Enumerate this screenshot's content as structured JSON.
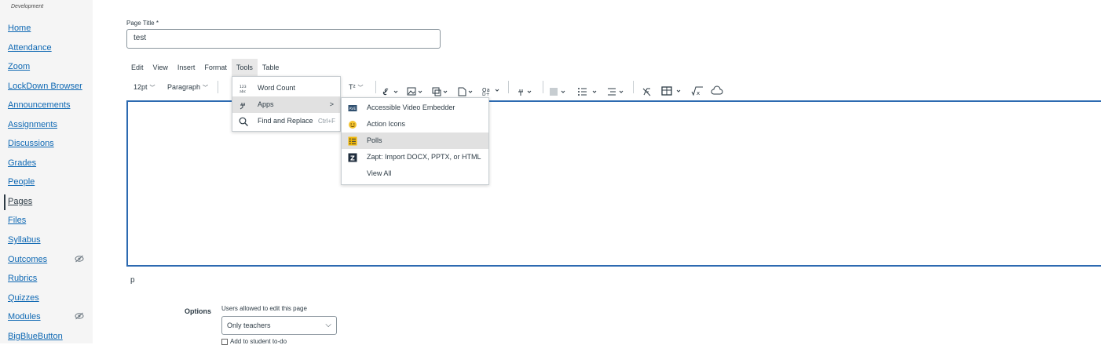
{
  "sidebar": {
    "env_label": "Development",
    "items": [
      {
        "label": "Home"
      },
      {
        "label": "Attendance"
      },
      {
        "label": "Zoom"
      },
      {
        "label": "LockDown Browser"
      },
      {
        "label": "Announcements"
      },
      {
        "label": "Assignments"
      },
      {
        "label": "Discussions"
      },
      {
        "label": "Grades"
      },
      {
        "label": "People"
      },
      {
        "label": "Pages"
      },
      {
        "label": "Files"
      },
      {
        "label": "Syllabus"
      },
      {
        "label": "Outcomes"
      },
      {
        "label": "Rubrics"
      },
      {
        "label": "Quizzes"
      },
      {
        "label": "Modules"
      },
      {
        "label": "BigBlueButton"
      }
    ],
    "active_item": "Pages"
  },
  "page_title": {
    "label": "Page Title",
    "required_mark": "*",
    "value": "test"
  },
  "menubar": [
    "Edit",
    "View",
    "Insert",
    "Format",
    "Tools",
    "Table"
  ],
  "toolbar": {
    "font_size": "12pt",
    "block_format": "Paragraph",
    "superscript": "T²"
  },
  "tools_menu": {
    "items": [
      {
        "label": "Word Count",
        "icon": "word-count-icon"
      },
      {
        "label": "Apps",
        "icon": "plug-icon",
        "has_submenu": true
      },
      {
        "label": "Find and Replace",
        "icon": "search-icon",
        "shortcut": "Ctrl+F"
      }
    ]
  },
  "apps_menu": {
    "items": [
      {
        "label": "Accessible Video Embedder",
        "icon": "video-embedder-icon"
      },
      {
        "label": "Action Icons",
        "icon": "action-icons-icon"
      },
      {
        "label": "Polls",
        "icon": "polls-icon"
      },
      {
        "label": "Zapt: Import DOCX, PPTX, or HTML",
        "icon": "zapt-icon"
      },
      {
        "label": "View All"
      }
    ],
    "highlighted": "Polls"
  },
  "editor": {
    "status_path": "p"
  },
  "options": {
    "label": "Options",
    "users_label": "Users allowed to edit this page",
    "selected": "Only teachers",
    "todo_label": "Add to student to-do"
  },
  "colors": {
    "link": "#0e68b3",
    "editor_border": "#2d6ab1",
    "sidebar_bg": "#f5f5f5"
  }
}
